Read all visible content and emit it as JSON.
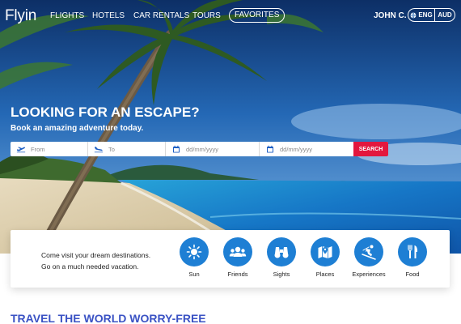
{
  "brand": {
    "logo": "Flyin"
  },
  "nav": {
    "links": [
      "FLIGHTS",
      "HOTELS",
      "CAR RENTALS",
      "TOURS"
    ],
    "favorites": "FAVORITES",
    "user": "JOHN C.",
    "language": "ENG",
    "currency": "AUD"
  },
  "hero": {
    "headline": "LOOKING FOR AN ESCAPE?",
    "subheadline": "Book an amazing adventure today."
  },
  "search": {
    "from_placeholder": "From",
    "to_placeholder": "To",
    "depart_placeholder": "dd/mm/yyyy",
    "return_placeholder": "dd/mm/yyyy",
    "button": "SEARCH"
  },
  "categories": {
    "intro_line1": "Come visit your dream destinations.",
    "intro_line2": "Go on a much needed vacation.",
    "items": [
      {
        "label": "Sun",
        "icon": "sun-icon"
      },
      {
        "label": "Friends",
        "icon": "friends-icon"
      },
      {
        "label": "Sights",
        "icon": "binoculars-icon"
      },
      {
        "label": "Places",
        "icon": "map-icon"
      },
      {
        "label": "Experiences",
        "icon": "skiing-icon"
      },
      {
        "label": "Food",
        "icon": "cutlery-icon"
      }
    ]
  },
  "section": {
    "title": "TRAVEL THE WORLD WORRY-FREE"
  },
  "colors": {
    "accent_blue": "#1e7fd4",
    "search_red": "#e3173e",
    "section_title": "#3a52c4"
  }
}
